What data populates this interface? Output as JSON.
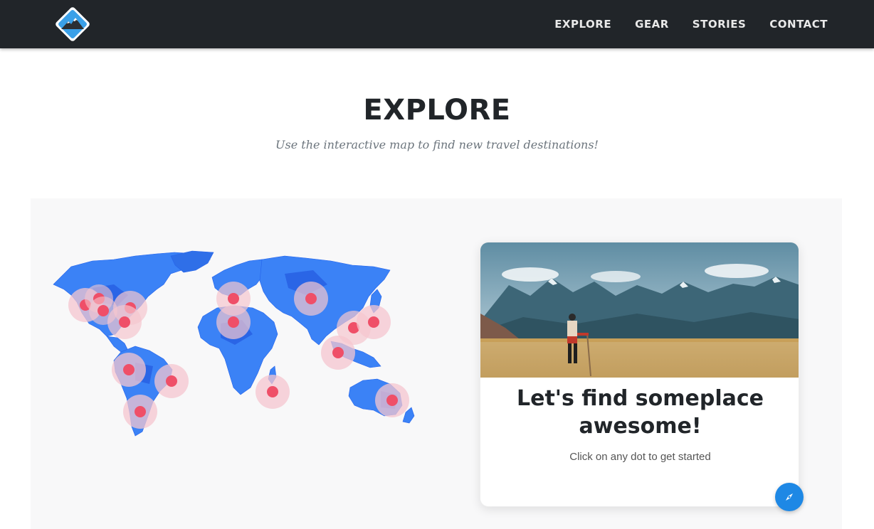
{
  "nav": {
    "items": [
      {
        "label": "EXPLORE"
      },
      {
        "label": "GEAR"
      },
      {
        "label": "STORIES"
      },
      {
        "label": "CONTACT"
      }
    ]
  },
  "page": {
    "title": "EXPLORE",
    "subtitle": "Use the interactive map to find new travel destinations!"
  },
  "card": {
    "title": "Let's find someplace awesome!",
    "text": "Click on any dot to get started"
  },
  "icons": {
    "logo": "mountain-logo-icon",
    "compass": "compass-icon"
  },
  "colors": {
    "header_bg": "#212529",
    "map_blue": "#3b82f6",
    "map_dark": "#1d4ed8",
    "dot": "#ef4f68",
    "dot_halo": "#f5c6cf",
    "accent": "#1e88e5"
  }
}
